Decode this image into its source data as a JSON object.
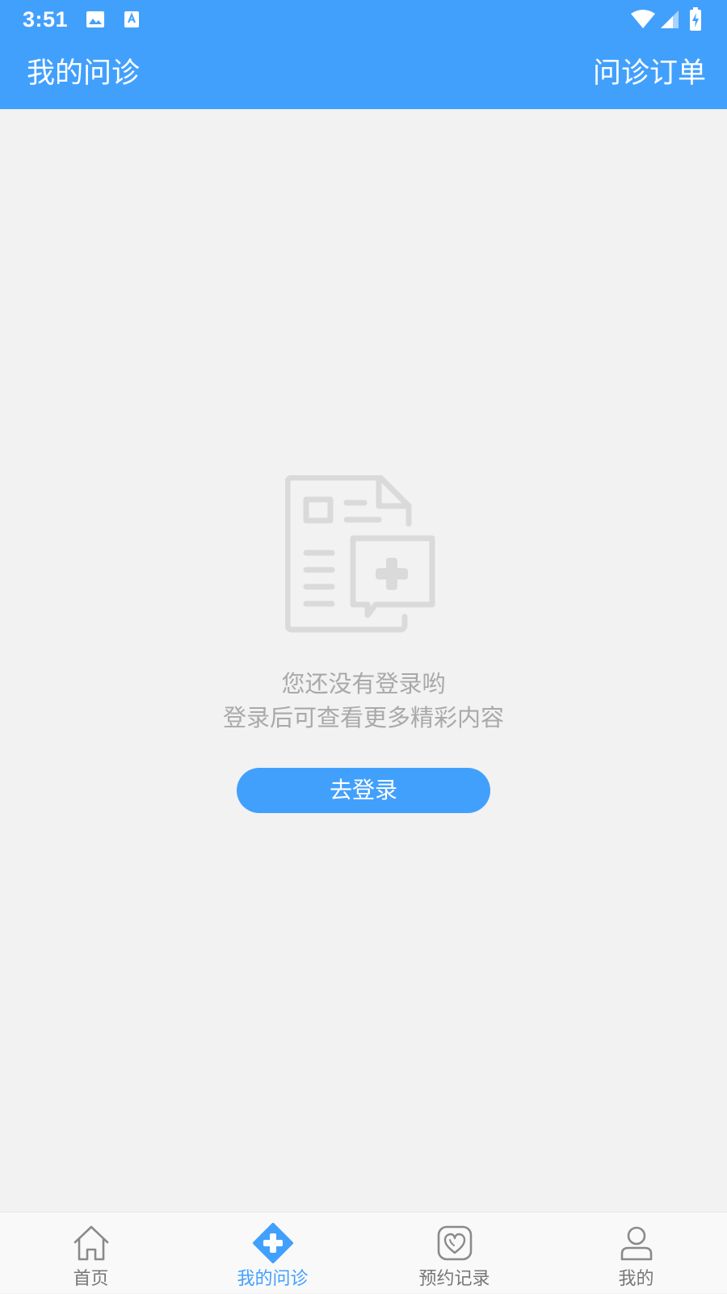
{
  "status_bar": {
    "time": "3:51",
    "icons": [
      "image-icon",
      "accessibility-icon",
      "wifi-icon",
      "signal-icon",
      "battery-charging-icon"
    ]
  },
  "app_bar": {
    "title": "我的问诊",
    "action_label": "问诊订单"
  },
  "empty_state": {
    "icon": "consultation-document-icon",
    "title": "您还没有登录哟",
    "subtitle": "登录后可查看更多精彩内容",
    "button_label": "去登录"
  },
  "bottom_nav": {
    "items": [
      {
        "label": "首页",
        "icon": "home-icon"
      },
      {
        "label": "我的问诊",
        "icon": "medical-plus-icon",
        "active": true
      },
      {
        "label": "预约记录",
        "icon": "heart-calendar-icon"
      },
      {
        "label": "我的",
        "icon": "person-icon"
      }
    ]
  },
  "colors": {
    "primary": "#42a0fd",
    "background": "#f2f2f2",
    "muted_text": "#a9a9a9",
    "nav_inactive": "#777777",
    "illustration": "#dadada"
  }
}
